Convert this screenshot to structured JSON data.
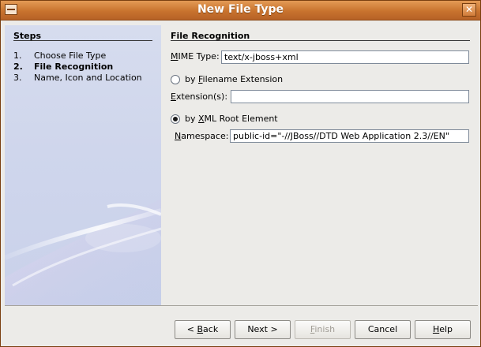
{
  "window": {
    "title": "New File Type"
  },
  "steps": {
    "heading": "Steps",
    "items": [
      {
        "num": "1.",
        "label": "Choose File Type"
      },
      {
        "num": "2.",
        "label": "File Recognition"
      },
      {
        "num": "3.",
        "label": "Name, Icon and Location"
      }
    ]
  },
  "form": {
    "heading": "File Recognition",
    "mime_label_pre": "M",
    "mime_label_rest": "IME Type:",
    "mime_value": "text/x-jboss+xml",
    "filename_radio_pre": "by ",
    "filename_radio_mnemonic": "F",
    "filename_radio_rest": "ilename Extension",
    "filename_selected": false,
    "extension_label_pre": "E",
    "extension_label_rest": "xtension(s):",
    "extension_value": "",
    "xml_radio_pre": "by ",
    "xml_radio_mnemonic": "X",
    "xml_radio_rest": "ML Root Element",
    "xml_selected": true,
    "namespace_label_pre": "N",
    "namespace_label_rest": "amespace:",
    "namespace_value": "public-id=\"-//JBoss//DTD Web Application 2.3//EN\""
  },
  "buttons": {
    "back_pre": "< ",
    "back_mnemonic": "B",
    "back_rest": "ack",
    "next": "Next >",
    "finish_mnemonic": "F",
    "finish_rest": "inish",
    "cancel": "Cancel",
    "help_mnemonic": "H",
    "help_rest": "elp",
    "finish_enabled": false
  }
}
